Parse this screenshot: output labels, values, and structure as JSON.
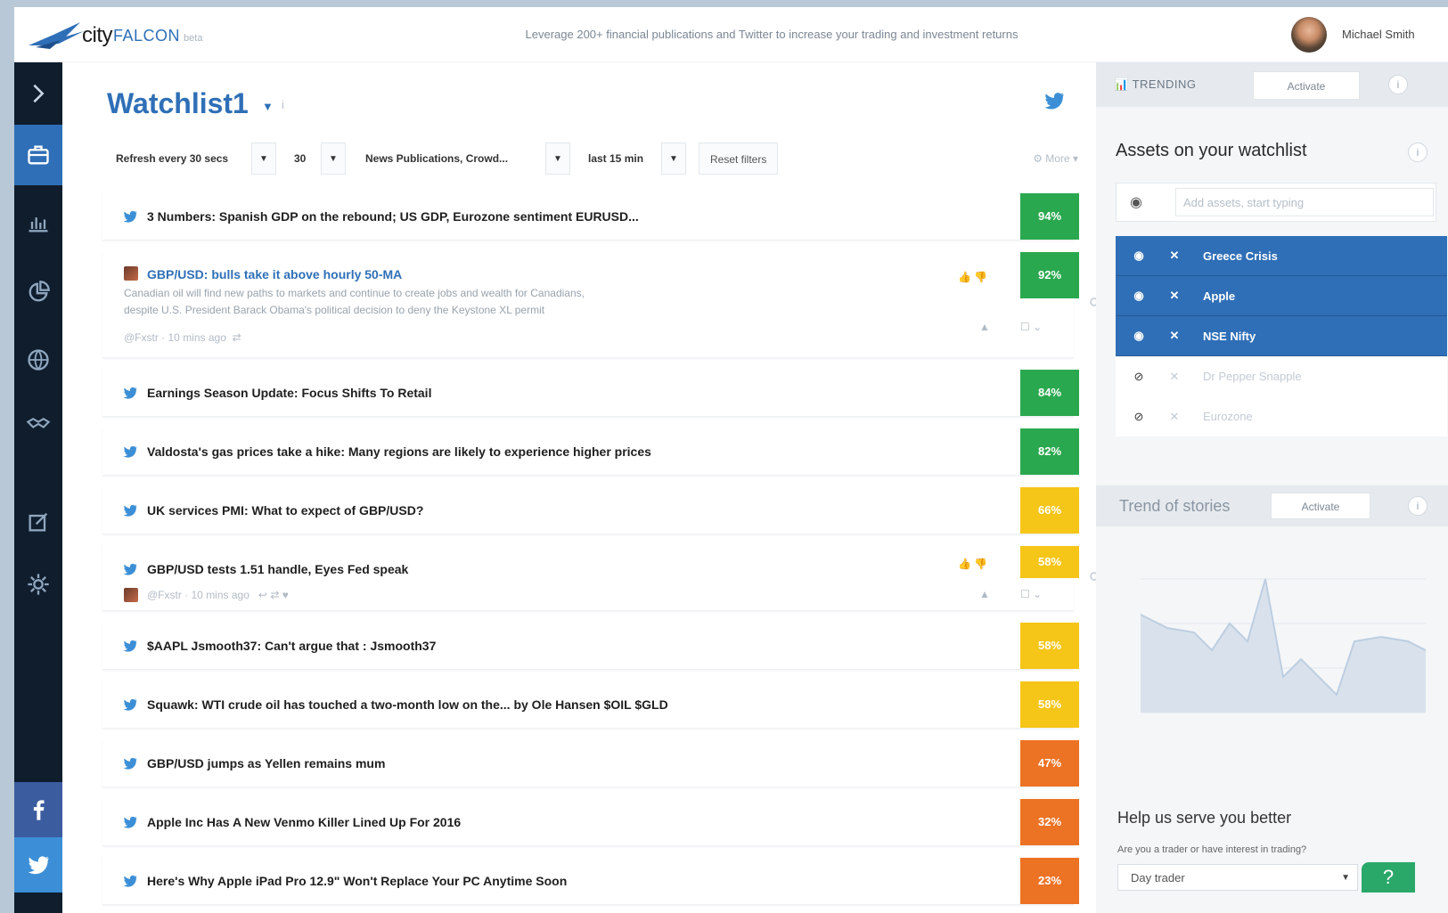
{
  "header": {
    "logo_city": "city",
    "logo_falcon": "FALCON",
    "logo_beta": "beta",
    "tagline": "Leverage 200+ financial publications and Twitter to increase your trading and investment returns",
    "user_name": "Michael Smith"
  },
  "sidebar": {
    "icons": [
      "chevron-right-icon",
      "briefcase-icon",
      "bar-chart-icon",
      "pie-chart-icon",
      "globe-icon",
      "handshake-icon",
      "edit-icon",
      "gear-icon",
      "facebook-icon",
      "twitter-icon"
    ]
  },
  "watchlist": {
    "title": "Watchlist1",
    "info": "i",
    "filters": {
      "refresh": "Refresh every 30 secs",
      "count": "30",
      "sources": "News Publications, Crowd...",
      "time": "last 15 min",
      "reset": "Reset filters",
      "more": "More"
    }
  },
  "feed": [
    {
      "title": "3 Numbers: Spanish GDP on the rebound; US GDP, Eurozone sentiment EURUSD...",
      "score": "94%"
    },
    {
      "title": "GBP/USD: bulls take it above hourly 50-MA",
      "score": "92%",
      "desc1": "Canadian oil will find new paths to markets and continue to create jobs and wealth for Canadians,",
      "desc2": "despite U.S. President Barack Obama's political decision to deny the Keystone XL permit",
      "meta": "@Fxstr · 10 mins ago"
    },
    {
      "title": "Earnings Season Update: Focus Shifts To Retail",
      "score": "84%"
    },
    {
      "title": "Valdosta's gas prices take a hike: Many regions are likely to experience higher prices",
      "score": "82%"
    },
    {
      "title": "UK services PMI: What to expect of GBP/USD?",
      "score": "66%"
    },
    {
      "title": "GBP/USD tests 1.51 handle, Eyes Fed speak",
      "score": "58%",
      "meta": "@Fxstr · 10 mins ago"
    },
    {
      "title": "$AAPL Jsmooth37: Can't argue that : Jsmooth37",
      "score": "58%"
    },
    {
      "title": "Squawk: WTI crude oil has touched a two-month low on the... by Ole Hansen $OIL $GLD",
      "score": "58%"
    },
    {
      "title": "GBP/USD jumps as Yellen remains mum",
      "score": "47%"
    },
    {
      "title": "Apple Inc Has A New Venmo Killer Lined Up For 2016",
      "score": "32%"
    },
    {
      "title": "Here's Why Apple iPad Pro 12.9\" Won't Replace Your PC Anytime Soon",
      "score": "23%"
    }
  ],
  "right_panel": {
    "tab_trending": "TRENDING",
    "tab_activate": "Activate",
    "assets_title": "Assets on your watchlist",
    "asset_placeholder": "Add assets, start typing",
    "assets_active": [
      "Greece Crisis",
      "Apple",
      "NSE Nifty"
    ],
    "assets_inactive": [
      "Dr Pepper Snapple",
      "Eurozone"
    ],
    "trend_title": "Trend of stories",
    "trend_activate": "Activate",
    "help_title": "Help us serve you better",
    "help_question": "Are you a trader or have interest in trading?",
    "help_option": "Day trader",
    "help_badge": "?"
  },
  "colors": {
    "brand_blue": "#2f6fb7",
    "sidebar_bg": "#0f1d2d",
    "score_green": "#2aa84f",
    "score_yellow": "#f5c518",
    "score_orange": "#ec7224"
  }
}
